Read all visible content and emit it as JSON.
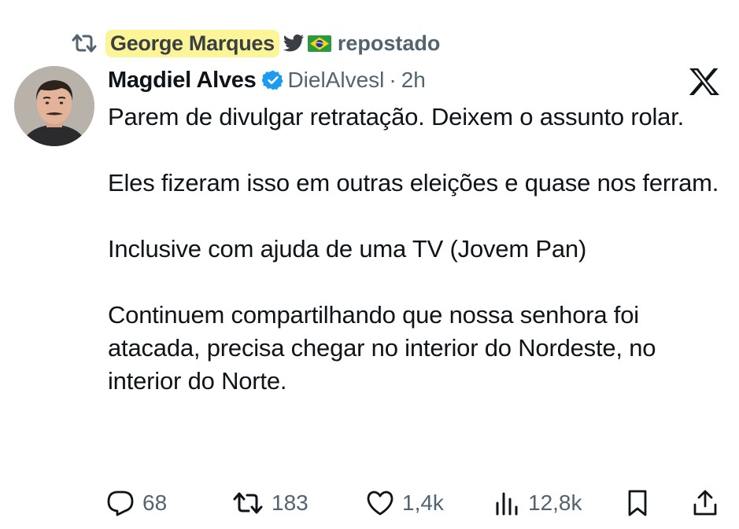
{
  "repost_header": {
    "reposter_name": "George Marques",
    "label": "repostado",
    "icons": [
      "repost-icon",
      "twitter-bird-icon",
      "brazil-flag-icon"
    ],
    "highlight_color": "#fbf598"
  },
  "tweet": {
    "author": {
      "display_name": "Magdiel Alves",
      "handle": "DielAlvesl",
      "verified": true,
      "verified_color": "#1d9bf0",
      "avatar": "avatar-photo"
    },
    "separator": "·",
    "time": "2h",
    "platform_logo": "x-logo-icon",
    "paragraphs": [
      "Parem de divulgar retratação. Deixem o assunto rolar.",
      "Eles fizeram isso em outras eleições e quase nos ferram.",
      "Inclusive com ajuda de uma TV (Jovem Pan)",
      "Continuem compartilhando que nossa senhora foi atacada, precisa chegar no interior do Nordeste, no interior do Norte."
    ]
  },
  "actions": {
    "replies": "68",
    "reposts": "183",
    "likes": "1,4k",
    "views": "12,8k",
    "icons": [
      "reply-icon",
      "repost-icon",
      "heart-icon",
      "views-icon",
      "bookmark-icon",
      "share-icon"
    ],
    "icon_color": "#536471"
  }
}
